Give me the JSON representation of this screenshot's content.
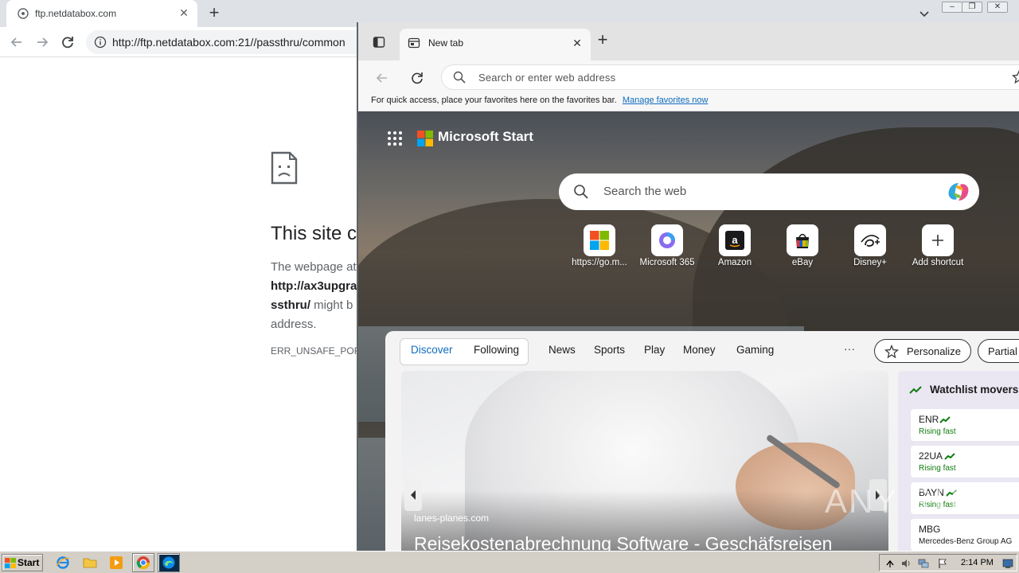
{
  "chrome": {
    "tab_title": "ftp.netdatabox.com",
    "url": "http://ftp.netdatabox.com:21//passthru/common",
    "error_heading": "This site ca",
    "error_body_pre": "The webpage at",
    "error_body_url1": "http://ax3upgra",
    "error_body_url2": "ssthru/",
    "error_body_mid": " might b",
    "error_body_post": "address.",
    "error_code": "ERR_UNSAFE_PORT"
  },
  "edge": {
    "tab_title": "New tab",
    "address_placeholder": "Search or enter web address",
    "favbar_message": "For quick access, place your favorites here on the favorites bar.",
    "favbar_link": "Manage favorites now",
    "brand": "Microsoft Start",
    "search_placeholder": "Search the web",
    "shortcuts": [
      {
        "label": "https://go.m...",
        "icon": "microsoft-icon"
      },
      {
        "label": "Microsoft 365",
        "icon": "m365-icon"
      },
      {
        "label": "Amazon",
        "icon": "amazon-icon"
      },
      {
        "label": "eBay",
        "icon": "ebay-icon"
      },
      {
        "label": "Disney+",
        "icon": "disney-icon"
      },
      {
        "label": "Add shortcut",
        "icon": "plus-icon"
      }
    ],
    "feed_tabs": {
      "discover": "Discover",
      "following": "Following",
      "news": "News",
      "sports": "Sports",
      "play": "Play",
      "money": "Money",
      "gaming": "Gaming",
      "more": "···",
      "personalize": "Personalize",
      "partial": "Partial"
    },
    "hero": {
      "source": "lanes-planes.com",
      "title": "Reisekostenabrechnung Software - Geschäfsreisen"
    },
    "watchlist": {
      "title": "Watchlist movers",
      "items": [
        {
          "symbol": "ENR",
          "status": "Rising fast"
        },
        {
          "symbol": "22UA",
          "status": "Rising fast"
        },
        {
          "symbol": "BAYN",
          "status": "Rising fast"
        },
        {
          "symbol": "MBG",
          "status": "Mercedes-Benz Group AG"
        }
      ]
    },
    "watermark": "ANY RUN",
    "accent_color": "#0f6cbd",
    "rising_color": "#107c10"
  },
  "taskbar": {
    "start_label": "Start",
    "clock": "2:14 PM"
  }
}
